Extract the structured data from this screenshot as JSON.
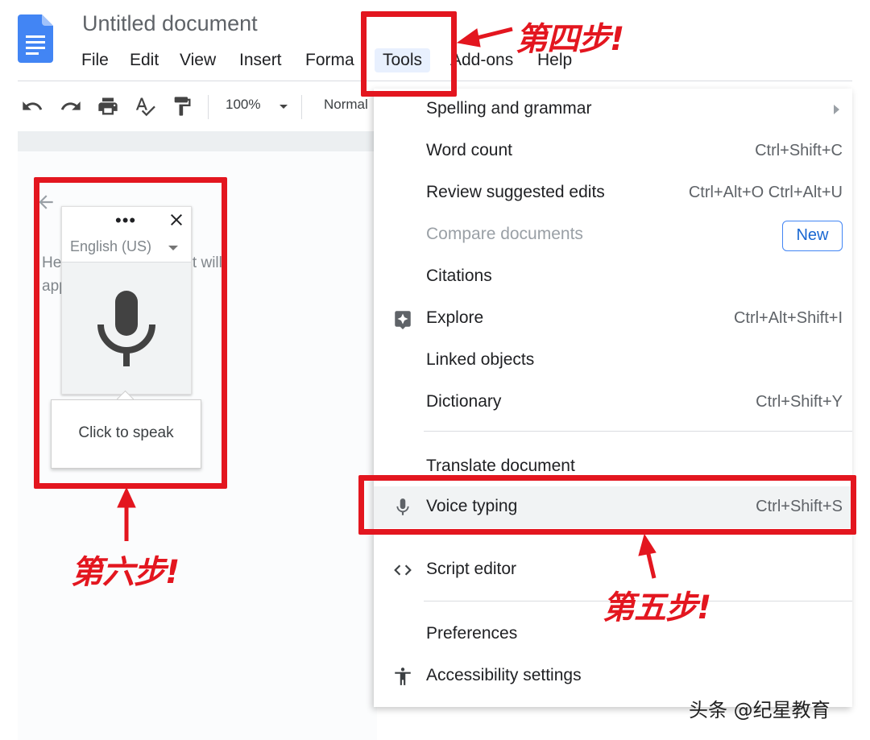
{
  "window": {
    "title": "Untitled document",
    "menubar": [
      "File",
      "Edit",
      "View",
      "Insert",
      "Forma",
      "Tools",
      "Add-ons",
      "Help"
    ]
  },
  "toolbar": {
    "icons": [
      "undo-icon",
      "redo-icon",
      "print-icon",
      "spellcheck-icon",
      "paint-format-icon"
    ],
    "zoom": "100%",
    "style": "Normal"
  },
  "document": {
    "hint_line1": "He          the document will",
    "hint_line2": "app"
  },
  "voice_widget": {
    "menu_icon": "more-dots-icon",
    "close_icon": "close-icon",
    "language": "English (US)",
    "mic_icon": "microphone-icon",
    "tooltip": "Click to speak"
  },
  "tools_menu": {
    "items": [
      {
        "label": "Spelling and grammar",
        "shortcut": "",
        "submenu": true
      },
      {
        "label": "Word count",
        "shortcut": "Ctrl+Shift+C"
      },
      {
        "label": "Review suggested edits",
        "shortcut": "Ctrl+Alt+O Ctrl+Alt+U"
      },
      {
        "label": "Compare documents",
        "badge": "New",
        "disabled": true
      },
      {
        "label": "Citations",
        "shortcut": ""
      },
      {
        "label": "Explore",
        "shortcut": "Ctrl+Alt+Shift+I",
        "icon": "explore-icon"
      },
      {
        "label": "Linked objects",
        "shortcut": ""
      },
      {
        "label": "Dictionary",
        "shortcut": "Ctrl+Shift+Y"
      },
      {
        "label": "Translate document",
        "shortcut": ""
      },
      {
        "label": "Voice typing",
        "shortcut": "Ctrl+Shift+S",
        "icon": "microphone-icon"
      },
      {
        "label": "Script editor",
        "shortcut": "",
        "icon": "code-icon"
      },
      {
        "label": "Preferences",
        "shortcut": ""
      },
      {
        "label": "Accessibility settings",
        "shortcut": "",
        "icon": "accessibility-icon"
      }
    ]
  },
  "annotations": {
    "step4": "第四步!",
    "step5": "第五步!",
    "step6": "第六步!",
    "color": "#e3161f"
  },
  "watermark": "头条 @纪星教育",
  "colors": {
    "menu_highlight": "#e8f0fe",
    "badge_blue": "#1967d2",
    "doc_blue": "#4285f4"
  }
}
